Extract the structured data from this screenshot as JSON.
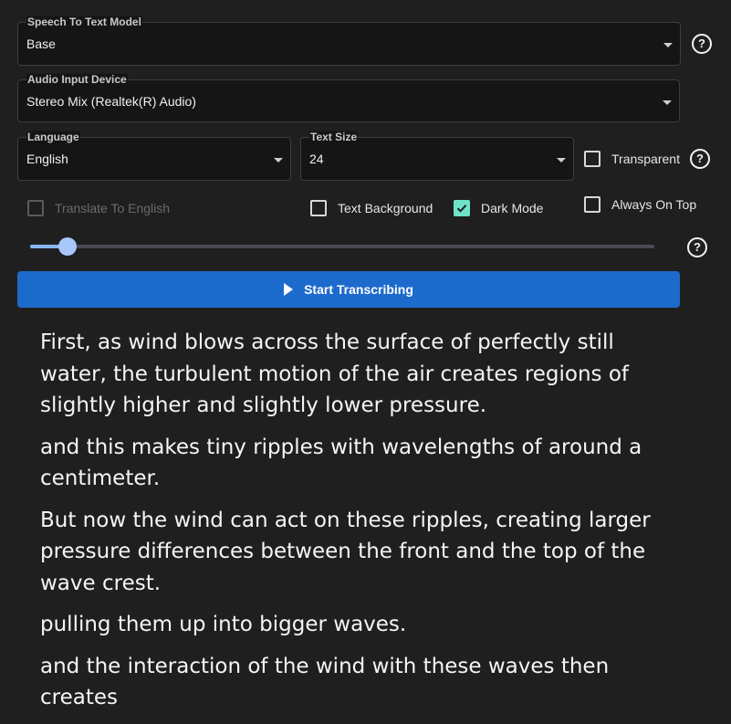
{
  "model": {
    "label": "Speech To Text Model",
    "value": "Base"
  },
  "device": {
    "label": "Audio Input Device",
    "value": "Stereo Mix (Realtek(R) Audio)"
  },
  "language": {
    "label": "Language",
    "value": "English"
  },
  "text_size": {
    "label": "Text Size",
    "value": "24"
  },
  "options": {
    "transparent": {
      "label": "Transparent",
      "checked": false
    },
    "translate": {
      "label": "Translate To English",
      "checked": false,
      "disabled": true
    },
    "text_background": {
      "label": "Text Background",
      "checked": false
    },
    "dark_mode": {
      "label": "Dark Mode",
      "checked": true
    },
    "always_on_top": {
      "label": "Always On Top",
      "checked": false
    }
  },
  "slider": {
    "value_fraction": 0.06
  },
  "start_button": {
    "label": "Start Transcribing"
  },
  "help": {
    "glyph": "?"
  },
  "colors": {
    "accent_button": "#1c6bcc",
    "checkbox_checked": "#6ee3c8",
    "slider": "#a8c7fa"
  },
  "transcript": [
    "First, as wind blows across the surface of perfectly still water, the turbulent motion of the air creates regions of slightly higher and slightly lower pressure.",
    "and this makes tiny ripples with wavelengths of around a centimeter.",
    "But now the wind can act on these ripples, creating larger pressure differences between the front and the top of the wave crest.",
    "pulling them up into bigger waves.",
    "and the interaction of the wind with these waves then creates"
  ]
}
